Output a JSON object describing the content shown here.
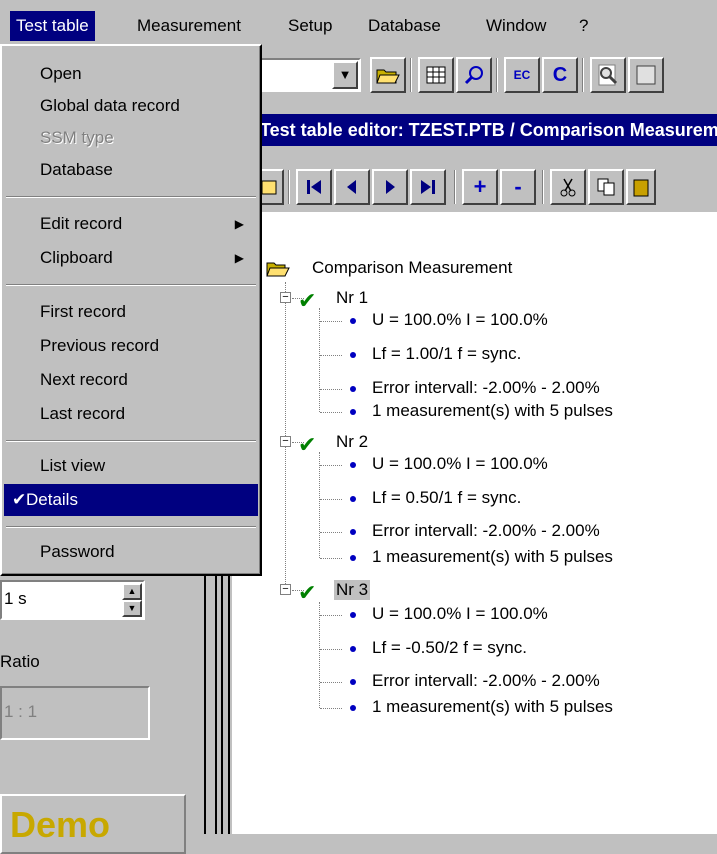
{
  "menubar": {
    "items": [
      "Test table",
      "Measurement",
      "Setup",
      "Database",
      "Window",
      "?"
    ]
  },
  "dropdown": {
    "open": "Open",
    "global_data_record": "Global data record",
    "ssm_type": "SSM type",
    "database": "Database",
    "edit_record": "Edit record",
    "clipboard": "Clipboard",
    "first_record": "First record",
    "previous_record": "Previous record",
    "next_record": "Next record",
    "last_record": "Last record",
    "list_view": "List view",
    "details": "Details",
    "password": "Password"
  },
  "toolbar": {
    "ec_label": "EC",
    "c_label": "C"
  },
  "title": "Test table editor: TZEST.PTB / Comparison Measurement",
  "toolbar2": {
    "add_label": "+",
    "remove_label": "-"
  },
  "left_panel": {
    "interval_value": "1 s",
    "ratio_label": "Ratio",
    "ratio_value": "1 : 1",
    "demo_label": "Demo"
  },
  "tree": {
    "root": "Comparison Measurement",
    "nodes": [
      {
        "label": "Nr 1",
        "lines": [
          "U = 100.0%   I = 100.0%",
          "Lf =  1.00/1  f = sync.",
          "Error intervall:  -2.00% -  2.00%",
          "1 measurement(s) with  5 pulses"
        ]
      },
      {
        "label": "Nr 2",
        "lines": [
          "U = 100.0%   I = 100.0%",
          "Lf =  0.50/1  f = sync.",
          "Error intervall:  -2.00% -  2.00%",
          "1 measurement(s) with  5 pulses"
        ]
      },
      {
        "label": "Nr 3",
        "lines": [
          "U = 100.0%   I = 100.0%",
          "Lf = -0.50/2  f = sync.",
          "Error intervall:  -2.00% -  2.00%",
          "1 measurement(s) with  5 pulses"
        ]
      }
    ]
  },
  "colors": {
    "menu_highlight": "#000080",
    "check_green": "#008000",
    "bullet_blue": "#0000c0",
    "demo_gold": "#c8a800"
  }
}
